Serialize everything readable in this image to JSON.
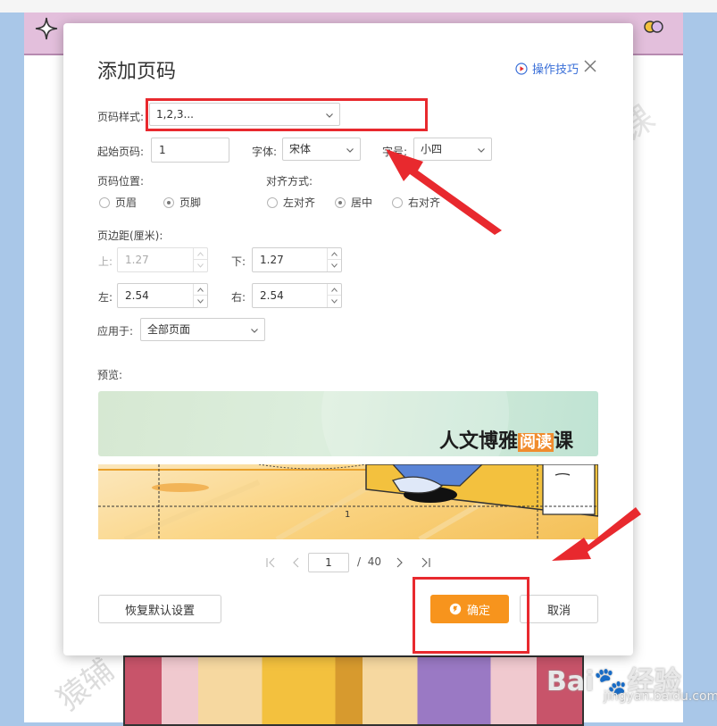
{
  "dialog": {
    "title": "添加页码",
    "tips_label": "操作技巧"
  },
  "page_style": {
    "label": "页码样式:",
    "value": "1,2,3..."
  },
  "start_page": {
    "label": "起始页码:",
    "value": "1"
  },
  "font": {
    "label": "字体:",
    "value": "宋体"
  },
  "font_size": {
    "label": "字号:",
    "value": "小四"
  },
  "position": {
    "label": "页码位置:",
    "options": [
      {
        "label": "页眉",
        "selected": false
      },
      {
        "label": "页脚",
        "selected": true
      }
    ]
  },
  "alignment": {
    "label": "对齐方式:",
    "options": [
      {
        "label": "左对齐",
        "selected": false
      },
      {
        "label": "居中",
        "selected": true
      },
      {
        "label": "右对齐",
        "selected": false
      }
    ]
  },
  "margins": {
    "label": "页边距(厘米):",
    "top_label": "上:",
    "top_value": "1.27",
    "bottom_label": "下:",
    "bottom_value": "1.27",
    "left_label": "左:",
    "left_value": "2.54",
    "right_label": "右:",
    "right_value": "2.54"
  },
  "apply_to": {
    "label": "应用于:",
    "value": "全部页面"
  },
  "preview": {
    "label": "预览:",
    "banner_text": "人文博雅",
    "banner_highlight": "阅读",
    "banner_suffix": "课",
    "page_number": "1"
  },
  "pager": {
    "current": "1",
    "separator": "/",
    "total": "40"
  },
  "buttons": {
    "restore": "恢复默认设置",
    "confirm": "确定",
    "cancel": "取消"
  },
  "background": {
    "watermark_top": "课",
    "watermark_bottom": "猿辅",
    "baidu_logo": "Bai🐾经验",
    "baidu_url": "jingyan.baidu.com"
  },
  "colors": {
    "accent": "#f7941d",
    "link": "#3a6fd8",
    "annotation_red": "#e8292e"
  }
}
